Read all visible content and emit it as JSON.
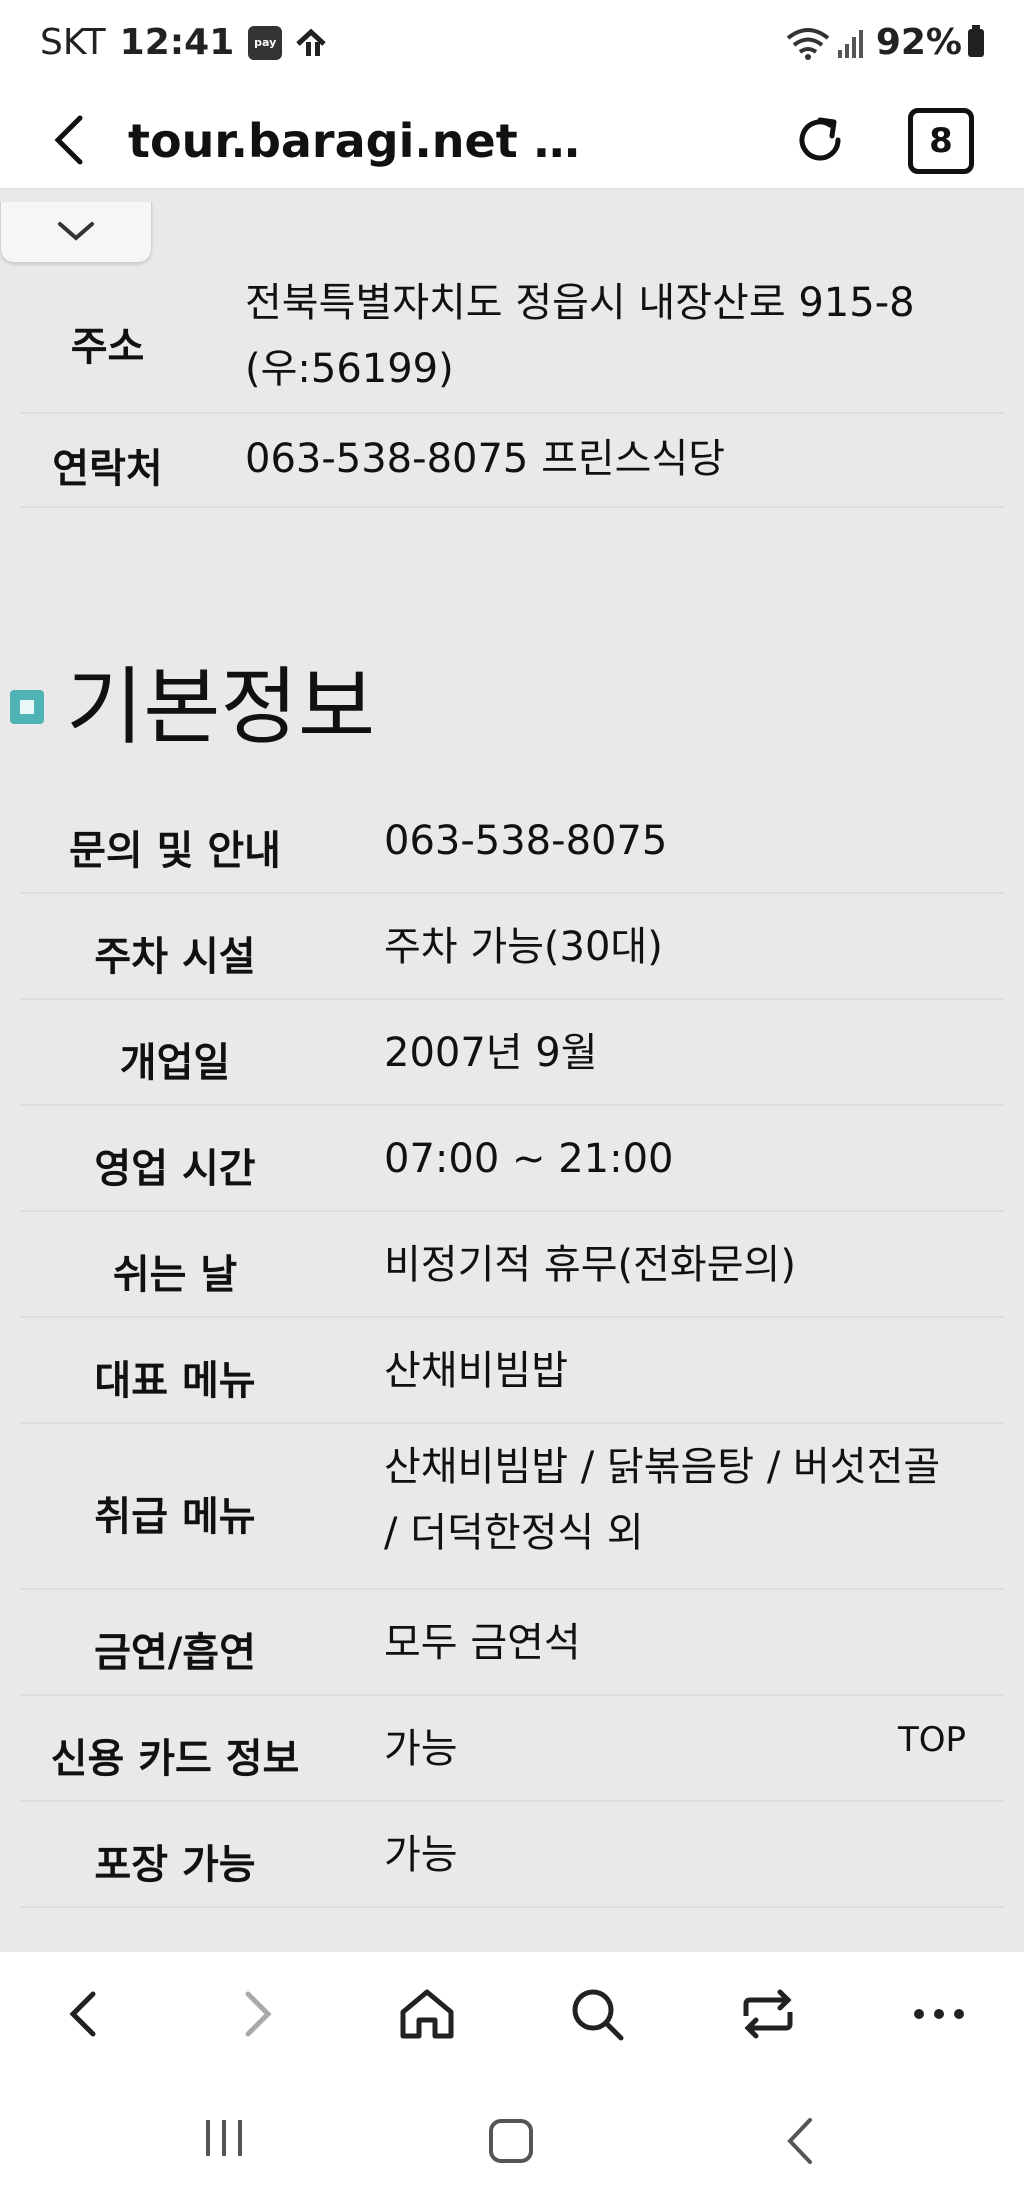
{
  "status": {
    "carrier": "SKT",
    "time": "12:41",
    "pay_badge": "pay",
    "battery": "92%"
  },
  "browser": {
    "url": "tour.baragi.net …",
    "tab_count": "8"
  },
  "info_top": [
    {
      "label": "주소",
      "value_line1": "전북특별자치도 정읍시 내장산로 915-8",
      "value_line2": "(우:56199)"
    },
    {
      "label": "연락처",
      "value": "063-538-8075 프린스식당"
    }
  ],
  "section": {
    "title": "기본정보"
  },
  "basic_info": [
    {
      "label": "문의 및 안내",
      "value": "063-538-8075"
    },
    {
      "label": "주차 시설",
      "value": "주차 가능(30대)"
    },
    {
      "label": "개업일",
      "value": "2007년 9월"
    },
    {
      "label": "영업 시간",
      "value": "07:00 ~ 21:00"
    },
    {
      "label": "쉬는 날",
      "value": "비정기적 휴무(전화문의)"
    },
    {
      "label": "대표 메뉴",
      "value": "산채비빔밥"
    },
    {
      "label": "취급 메뉴",
      "value_line1": "산채비빔밥 / 닭볶음탕 / 버섯전골",
      "value_line2": "/ 더덕한정식 외"
    },
    {
      "label": "금연/흡연",
      "value": "모두 금연석"
    },
    {
      "label": "신용 카드 정보",
      "value": "가능"
    },
    {
      "label": "포장 가능",
      "value": "가능"
    }
  ],
  "top_link": "TOP",
  "icons": {
    "back": "back-arrow-icon",
    "reload": "reload-icon",
    "collapse": "chevron-down-icon",
    "home": "home-icon",
    "search": "search-icon",
    "swap": "swap-icon",
    "more": "more-icon"
  },
  "colors": {
    "page_bg": "#e9e9ea",
    "section_icon": "#4fb3b6"
  }
}
